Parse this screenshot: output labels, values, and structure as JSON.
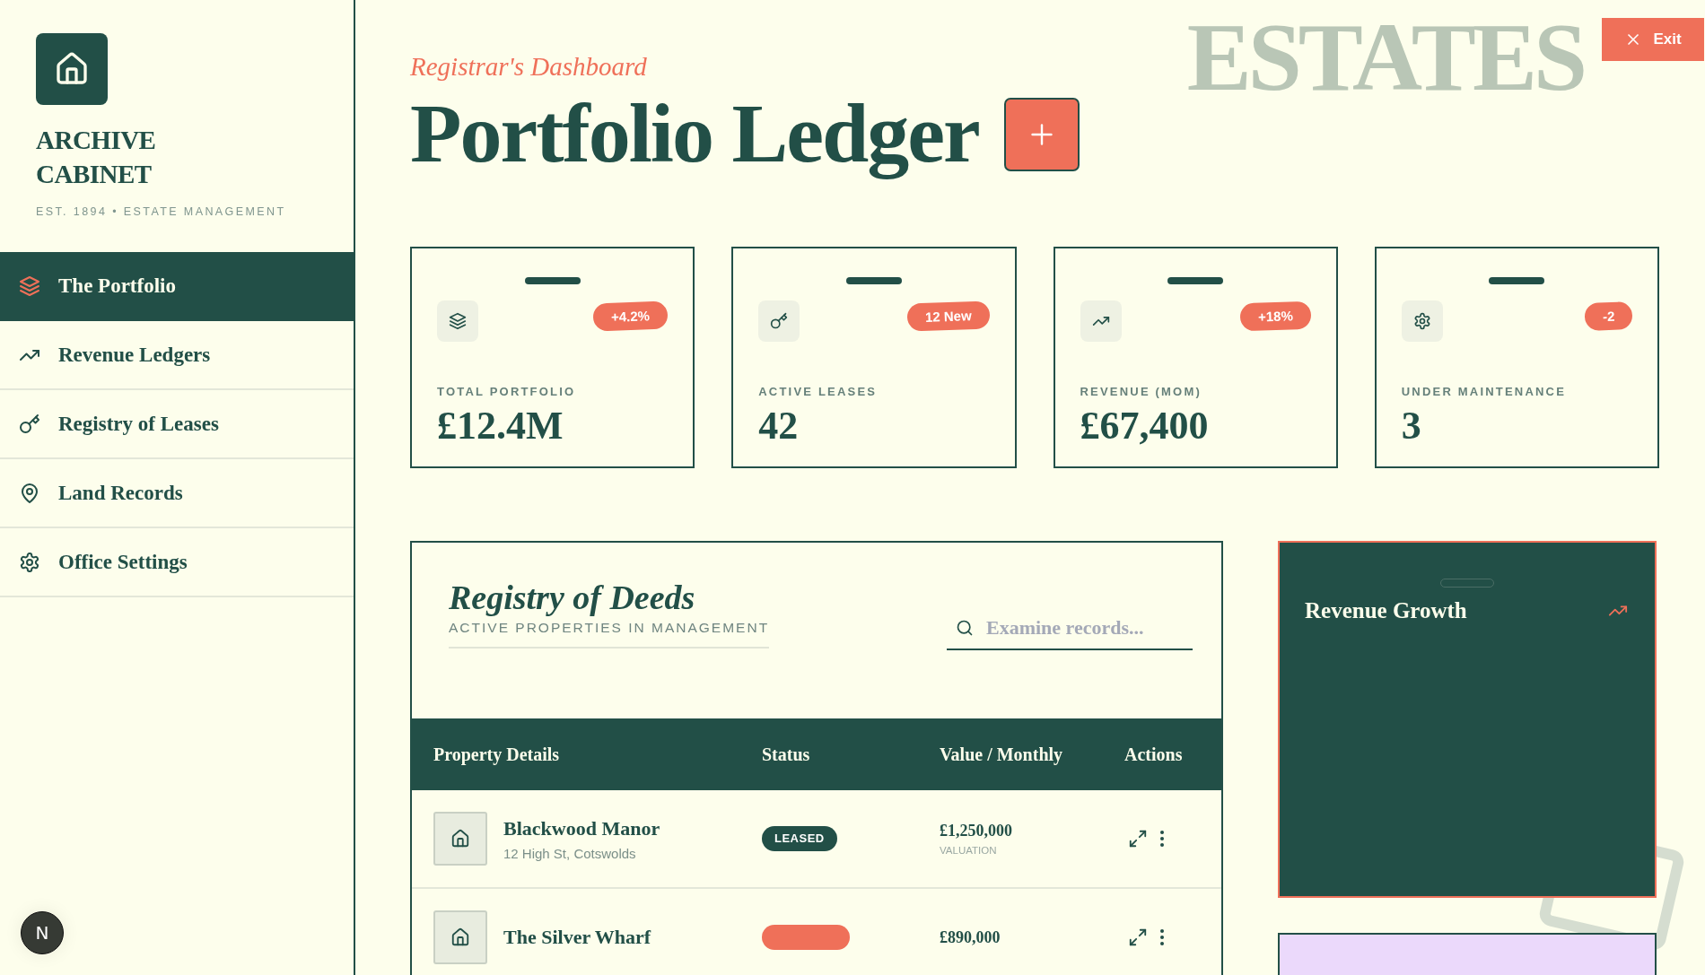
{
  "sidebar": {
    "brand": "ARCHIVE CABINET",
    "tagline": "EST. 1894 • ESTATE MANAGEMENT",
    "nav": [
      {
        "label": "The Portfolio",
        "selected": true
      },
      {
        "label": "Revenue Ledgers",
        "selected": false
      },
      {
        "label": "Registry of Leases",
        "selected": false
      },
      {
        "label": "Land Records",
        "selected": false
      },
      {
        "label": "Office Settings",
        "selected": false
      }
    ]
  },
  "header": {
    "background_word": "ESTATES",
    "eyebrow": "Registrar's Dashboard",
    "title": "Portfolio Ledger"
  },
  "exit_button": {
    "label": "Exit"
  },
  "stats": [
    {
      "label": "TOTAL PORTFOLIO",
      "value": "£12.4M",
      "badge": "+4.2%"
    },
    {
      "label": "ACTIVE LEASES",
      "value": "42",
      "badge": "12 New"
    },
    {
      "label": "REVENUE (MOM)",
      "value": "£67,400",
      "badge": "+18%"
    },
    {
      "label": "UNDER MAINTENANCE",
      "value": "3",
      "badge": "-2"
    }
  ],
  "registry": {
    "title": "Registry of Deeds",
    "subtitle": "ACTIVE PROPERTIES IN MANAGEMENT",
    "search": {
      "placeholder": "Examine records..."
    },
    "columns": [
      "Property Details",
      "Status",
      "Value / Monthly",
      "Actions"
    ],
    "rows": [
      {
        "name": "Blackwood Manor",
        "address": "12 High St, Cotswolds",
        "status": "LEASED",
        "color": "#224f47",
        "value": "£1,250,000",
        "value_note": "VALUATION"
      },
      {
        "name": "The Silver Wharf",
        "color": "#ef7059",
        "value": "£890,000"
      }
    ]
  },
  "revenue_panel": {
    "title": "Revenue Growth"
  },
  "dev_badge": {
    "label": "N"
  }
}
